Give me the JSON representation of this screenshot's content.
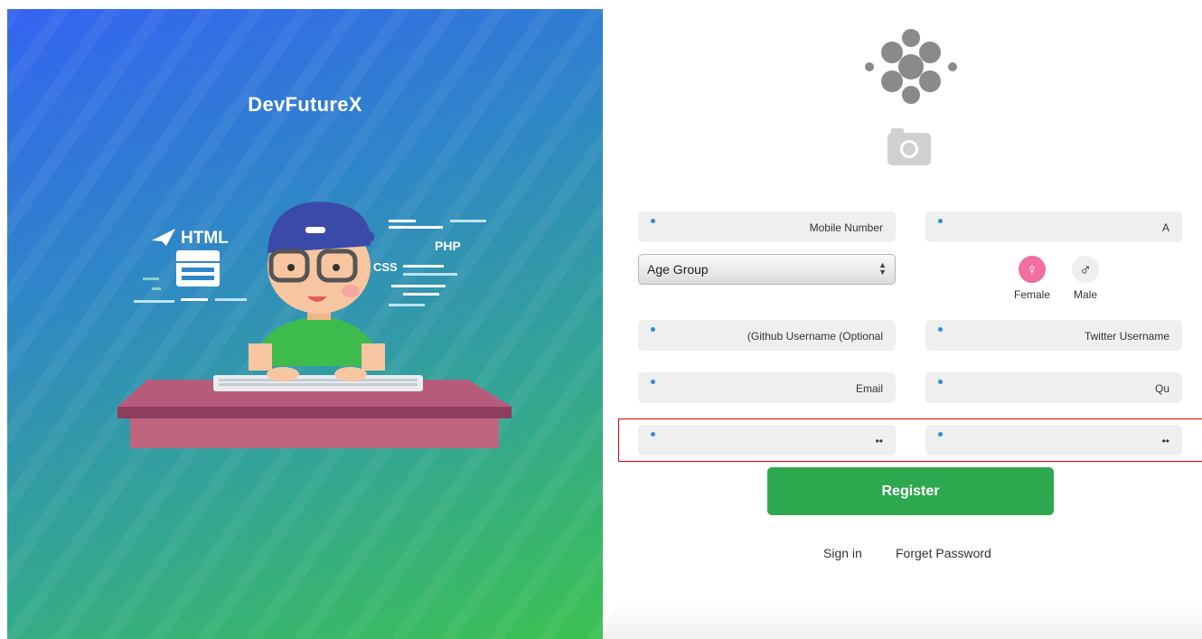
{
  "hero": {
    "brand": "DevFutureX",
    "tags": {
      "html": "HTML",
      "css": "CSS",
      "php": "PHP"
    }
  },
  "form": {
    "mobile": {
      "placeholder": "Mobile Number"
    },
    "field_a": {
      "placeholder": "A"
    },
    "age_group": {
      "value": "Age Group"
    },
    "gender": {
      "female": "Female",
      "male": "Male",
      "female_symbol": "♀",
      "male_symbol": "♂"
    },
    "github": {
      "placeholder": "(Github Username (Optional"
    },
    "twitter": {
      "placeholder": "Twitter Username"
    },
    "email": {
      "placeholder": "Email"
    },
    "field_qu": {
      "placeholder": "Qu"
    },
    "password": {
      "value": "••"
    },
    "confirm_password": {
      "value": "••"
    },
    "register_label": "Register",
    "signin_label": "Sign in",
    "forget_label": "Forget Password"
  },
  "colors": {
    "accent": "#2ea84e",
    "highlight": "#e00000",
    "female_badge": "#f06ea0",
    "dot": "#2a8cf0"
  }
}
